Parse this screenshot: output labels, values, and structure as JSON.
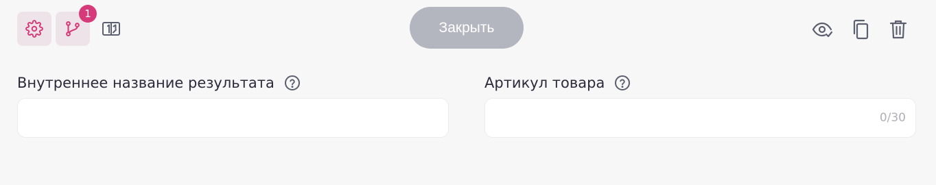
{
  "toolbar": {
    "branch_badge": "1",
    "close_label": "Закрыть"
  },
  "fields": {
    "internal_name": {
      "label": "Внутреннее название результата",
      "value": "",
      "placeholder": ""
    },
    "sku": {
      "label": "Артикул товара",
      "value": "",
      "placeholder": "",
      "counter": "0/30"
    }
  },
  "icons": {
    "left": [
      "gear-icon",
      "branch-icon",
      "binary-toggle-icon"
    ],
    "right": [
      "eye-check-icon",
      "copy-icon",
      "trash-icon"
    ],
    "help": "help-icon"
  },
  "colors": {
    "accent": "#d63a78",
    "active_bg": "#efe3ea",
    "button_disabled": "#b3b6bf",
    "icon_gray": "#5b5f6e"
  }
}
